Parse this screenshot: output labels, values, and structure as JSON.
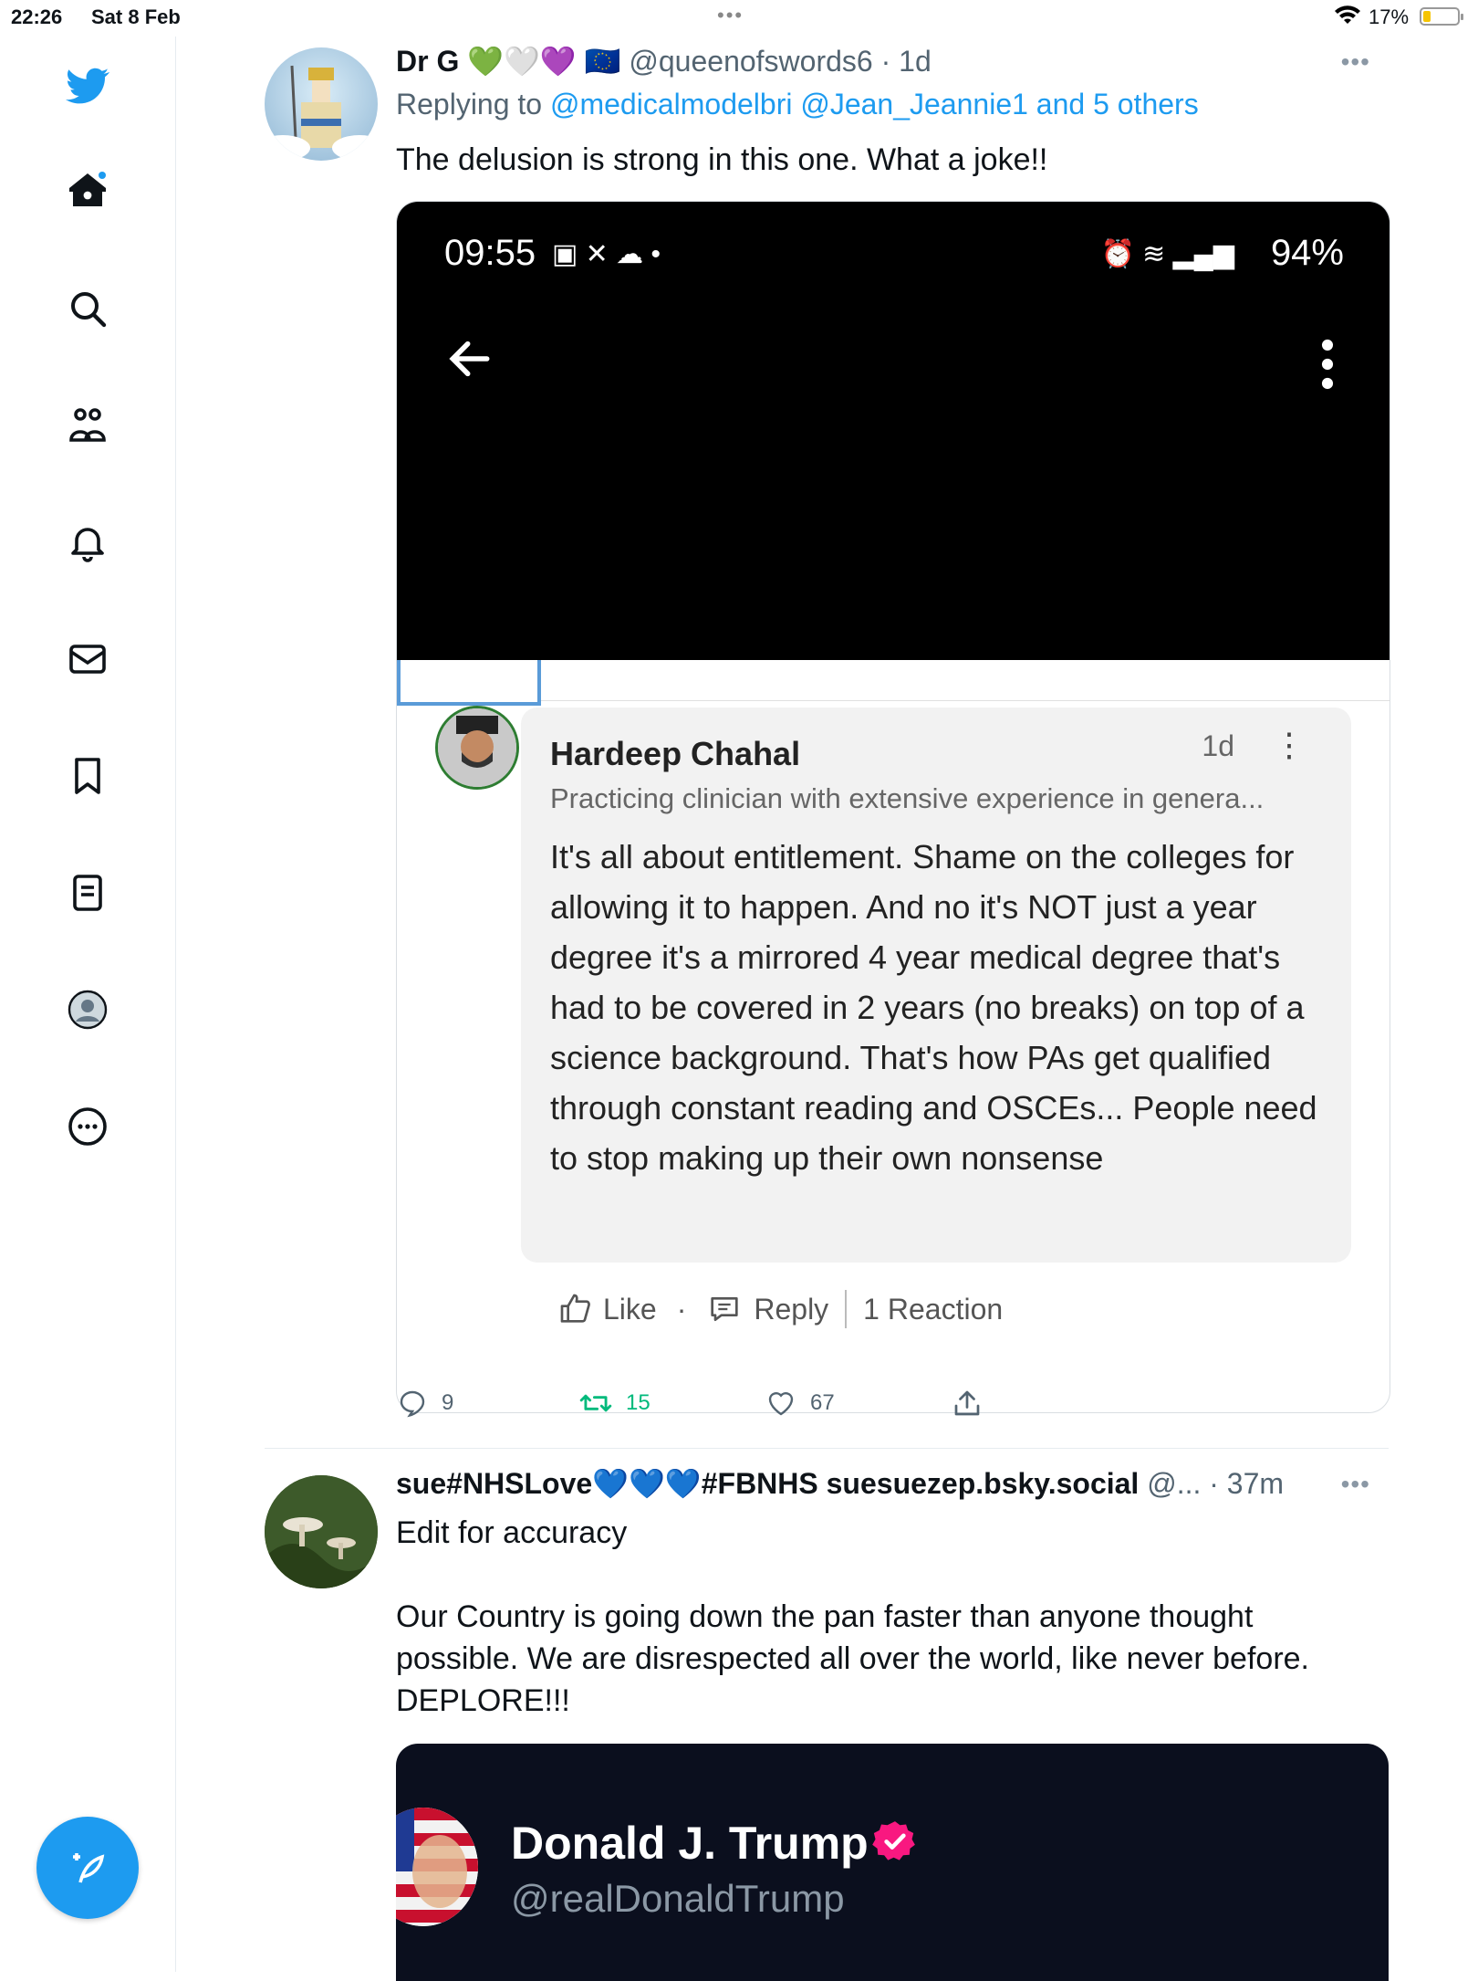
{
  "status_bar": {
    "time": "22:26",
    "date": "Sat 8 Feb",
    "battery": "17%"
  },
  "nav": {
    "items": [
      "twitter-logo",
      "home",
      "search",
      "communities",
      "notifications",
      "messages",
      "bookmarks",
      "lists",
      "profile",
      "more"
    ]
  },
  "tweet1": {
    "name": "Dr G",
    "emojis": "💚🤍💜",
    "flag": "🇪🇺",
    "handle_time": "@queenofswords6 · 1d",
    "replying_prefix": "Replying to",
    "replying_to": "@medicalmodelbri @Jean_Jeannie1 and 5 others",
    "text": "The delusion is strong in this one. What a joke!!",
    "screenshot": {
      "time": "09:55",
      "battery": "94%",
      "commenter": "Hardeep Chahal",
      "comment_time": "1d",
      "headline": "Practicing clinician with extensive experience in genera...",
      "comment": "It's all about entitlement. Shame on the colleges for allowing it to happen. And no it's NOT just a year degree it's a mirrored 4 year medical degree that's had to be covered in 2 years (no breaks) on top of a science background. That's how PAs get qualified through constant reading and OSCEs... People need to stop making up their own nonsense",
      "like": "Like",
      "reply": "Reply",
      "reactions": "1 Reaction"
    },
    "stats": {
      "replies": "9",
      "retweets": "15",
      "likes": "67"
    }
  },
  "tweet2": {
    "name": "sue#NHSLove💙💙💙#FBNHS suesuezep.bsky.social",
    "handle_time": "@... · 37m",
    "text_line1": "Edit for accuracy",
    "text_para": "Our Country is going down the pan faster than anyone thought possible. We are disrespected all over the world, like never before. DEPLORE!!!",
    "card_name": "Donald J. Trump",
    "card_handle": "@realDonaldTrump"
  },
  "colors": {
    "accent": "#1d9bf0",
    "retweet_green": "#00ba7c"
  }
}
